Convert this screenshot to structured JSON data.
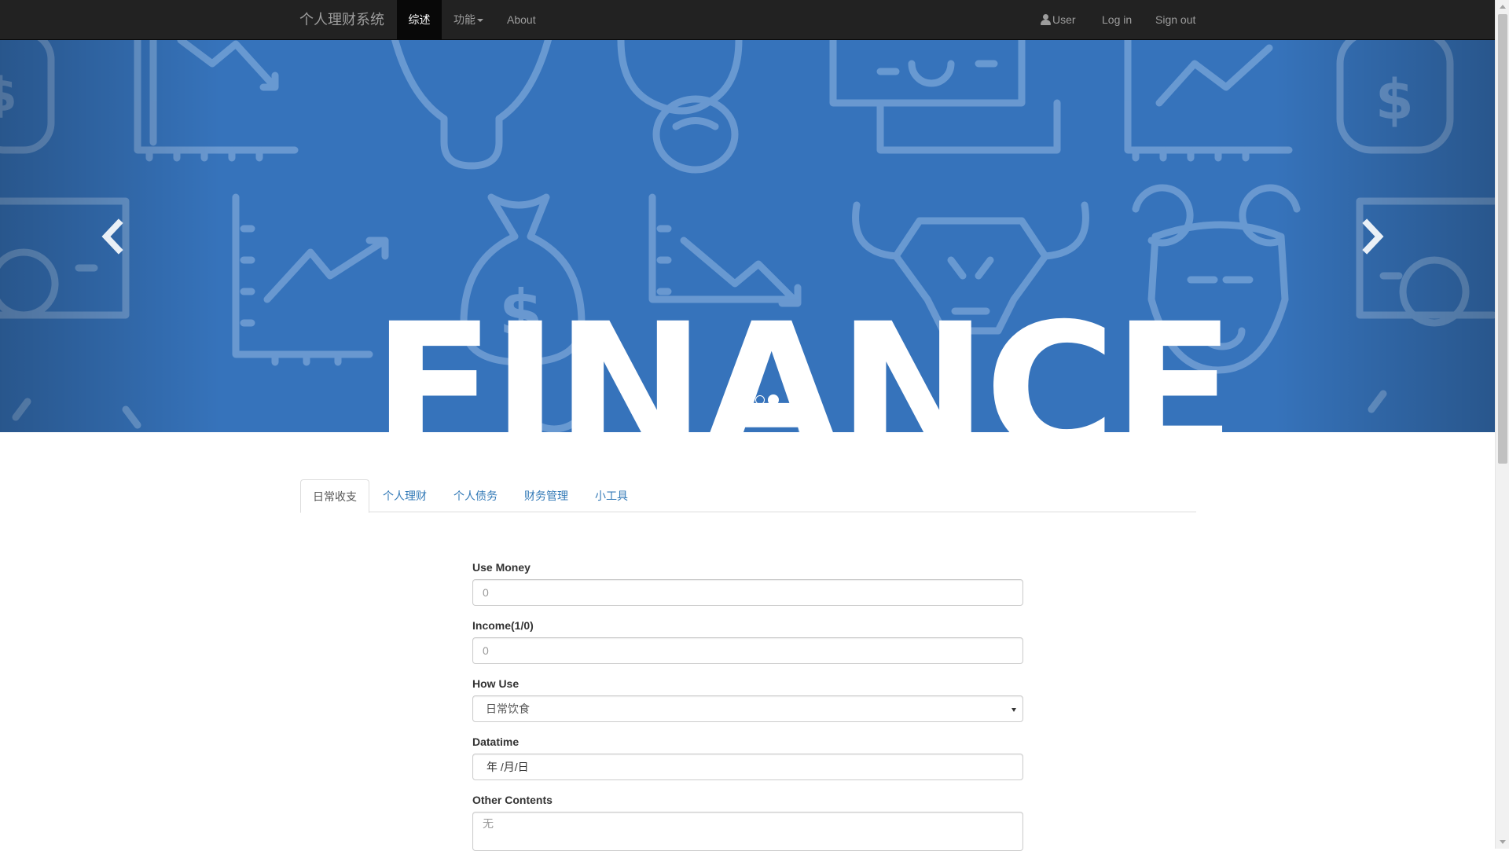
{
  "navbar": {
    "brand": "个人理财系统",
    "items": [
      {
        "label": "综述",
        "active": true
      },
      {
        "label": "功能",
        "dropdown": true
      },
      {
        "label": "About"
      }
    ],
    "right": {
      "user": "User",
      "login": "Log in",
      "signout": "Sign out"
    },
    "user_icon": "user-icon"
  },
  "carousel": {
    "hero_text": "FINANCE",
    "background_color": "#3673bb",
    "pattern_icons": [
      "dollar-bag-icon",
      "chart-down-icon",
      "chart-up-icon",
      "bull-icon",
      "bear-icon",
      "banknote-icon"
    ],
    "prev_icon": "chevron-left-icon",
    "next_icon": "chevron-right-icon",
    "slides": 3,
    "active_slide": 3
  },
  "tabs": [
    {
      "label": "日常收支",
      "active": true
    },
    {
      "label": "个人理财"
    },
    {
      "label": "个人债务"
    },
    {
      "label": "财务管理"
    },
    {
      "label": "小工具"
    }
  ],
  "form": {
    "use_money": {
      "label": "Use Money",
      "placeholder": "0"
    },
    "income": {
      "label": "Income(1/0)",
      "placeholder": "0"
    },
    "how_use": {
      "label": "How Use",
      "value": "日常饮食"
    },
    "datetime": {
      "label": "Datatime",
      "value": "年 /月/日"
    },
    "other": {
      "label": "Other Contents",
      "placeholder": "无"
    }
  },
  "colors": {
    "navbar": "#222222",
    "link": "#337ab7",
    "hero": "#3673bb"
  }
}
